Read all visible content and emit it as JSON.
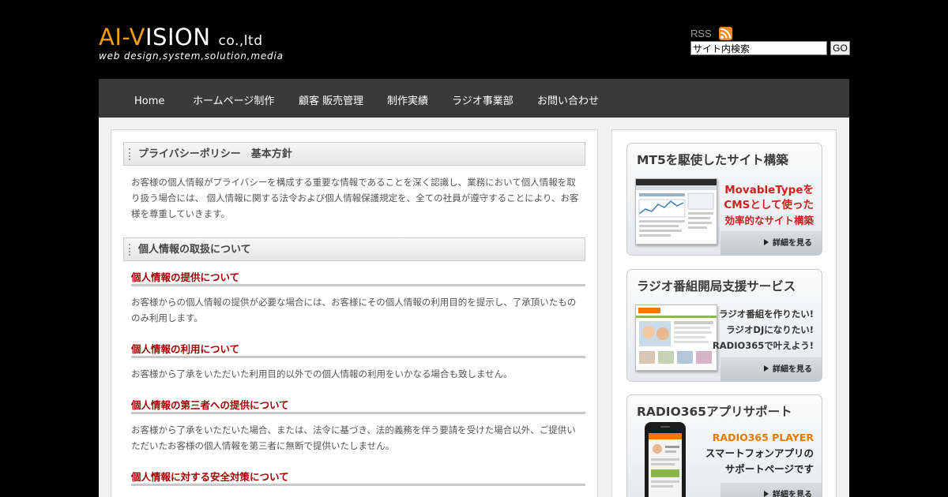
{
  "header": {
    "logo_prefix": "AI-",
    "logo_v": "V",
    "logo_rest": "ISION",
    "logo_suffix": "co.,ltd",
    "tagline": "web design,system,solution,media",
    "rss_label": "RSS",
    "search_value": "サイト内検索",
    "search_button": "GO"
  },
  "nav": {
    "items": [
      {
        "label": "Home"
      },
      {
        "label": "ホームページ制作"
      },
      {
        "label": "顧客 販売管理"
      },
      {
        "label": "制作実績"
      },
      {
        "label": "ラジオ事業部"
      },
      {
        "label": "お問い合わせ"
      }
    ]
  },
  "main": {
    "heading1": "プライバシーポリシー　基本方針",
    "intro": "お客様の個人情報がプライバシーを構成する重要な情報であることを深く認識し、業務において個人情報を取り扱う場合には、 個人情報に関する法令および個人情報保護規定を、全ての社員が遵守することにより、お客様を尊重していきます。",
    "heading2": "個人情報の取扱について",
    "sections": [
      {
        "title": "個人情報の提供について",
        "body": "お客様からの個人情報の提供が必要な場合には、お客様にその個人情報の利用目的を提示し、了承頂いたもののみ利用します。"
      },
      {
        "title": "個人情報の利用について",
        "body": "お客様から了承をいただいた利用目的以外での個人情報の利用をいかなる場合も致しません。"
      },
      {
        "title": "個人情報の第三者への提供について",
        "body": "お客様から了承をいただいた場合、または、法令に基づき、法的義務を伴う要請を受けた場合以外、ご提供いただいたお客様の個人情報を第三者に無断で提供いたしません。"
      },
      {
        "title": "個人情報に対する安全対策について",
        "body": ""
      }
    ]
  },
  "sidebar": {
    "banners": [
      {
        "title": "MT5を駆使したサイト構築",
        "lines": [
          "MovableTypeを",
          "CMSとして使った",
          "効率的なサイト構築"
        ],
        "more": "詳細を見る"
      },
      {
        "title": "ラジオ番組開局支援サービス",
        "lines": [
          "ラジオ番組を作りたい!",
          "ラジオDJになりたい!",
          "RADIO365で叶えよう!"
        ],
        "more": "詳細を見る"
      },
      {
        "title": "RADIO365アプリサポート",
        "lines": [
          "RADIO365 PLAYER",
          "スマートフォンアプリの",
          "サポートページです"
        ],
        "more": "詳細を見る"
      }
    ]
  },
  "colors": {
    "logo_accent": "#f39c12",
    "nav_bg": "#3a3a3a",
    "section_title": "#a10000",
    "banner_red": "#d21f1f",
    "banner_orange": "#e87a00"
  }
}
